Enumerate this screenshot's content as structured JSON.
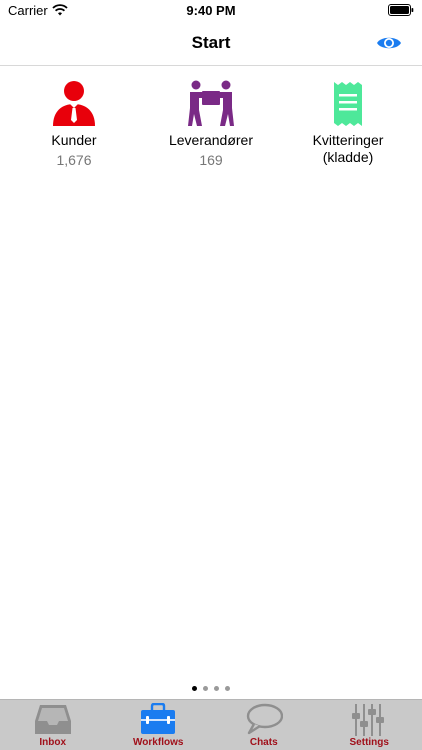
{
  "status_bar": {
    "carrier": "Carrier",
    "time": "9:40 PM"
  },
  "nav": {
    "title": "Start"
  },
  "tiles": [
    {
      "label": "Kunder",
      "count": "1,676",
      "icon": "customer-icon",
      "color": "#e8000b"
    },
    {
      "label": "Leverandører",
      "count": "169",
      "icon": "movers-icon",
      "color": "#7a2a86"
    },
    {
      "label": "Kvitteringer\n(kladde)",
      "count": "",
      "icon": "receipt-icon",
      "color": "#4ee89a"
    }
  ],
  "pager": {
    "total": 4,
    "active": 0
  },
  "tab_bar": {
    "tabs": [
      {
        "label": "Inbox",
        "icon": "inbox-icon"
      },
      {
        "label": "Workflows",
        "icon": "briefcase-icon",
        "selected": true
      },
      {
        "label": "Chats",
        "icon": "chat-bubble-icon"
      },
      {
        "label": "Settings",
        "icon": "sliders-icon"
      }
    ]
  },
  "colors": {
    "accent": "#1a7cf0",
    "tab_label": "#a0101a"
  }
}
